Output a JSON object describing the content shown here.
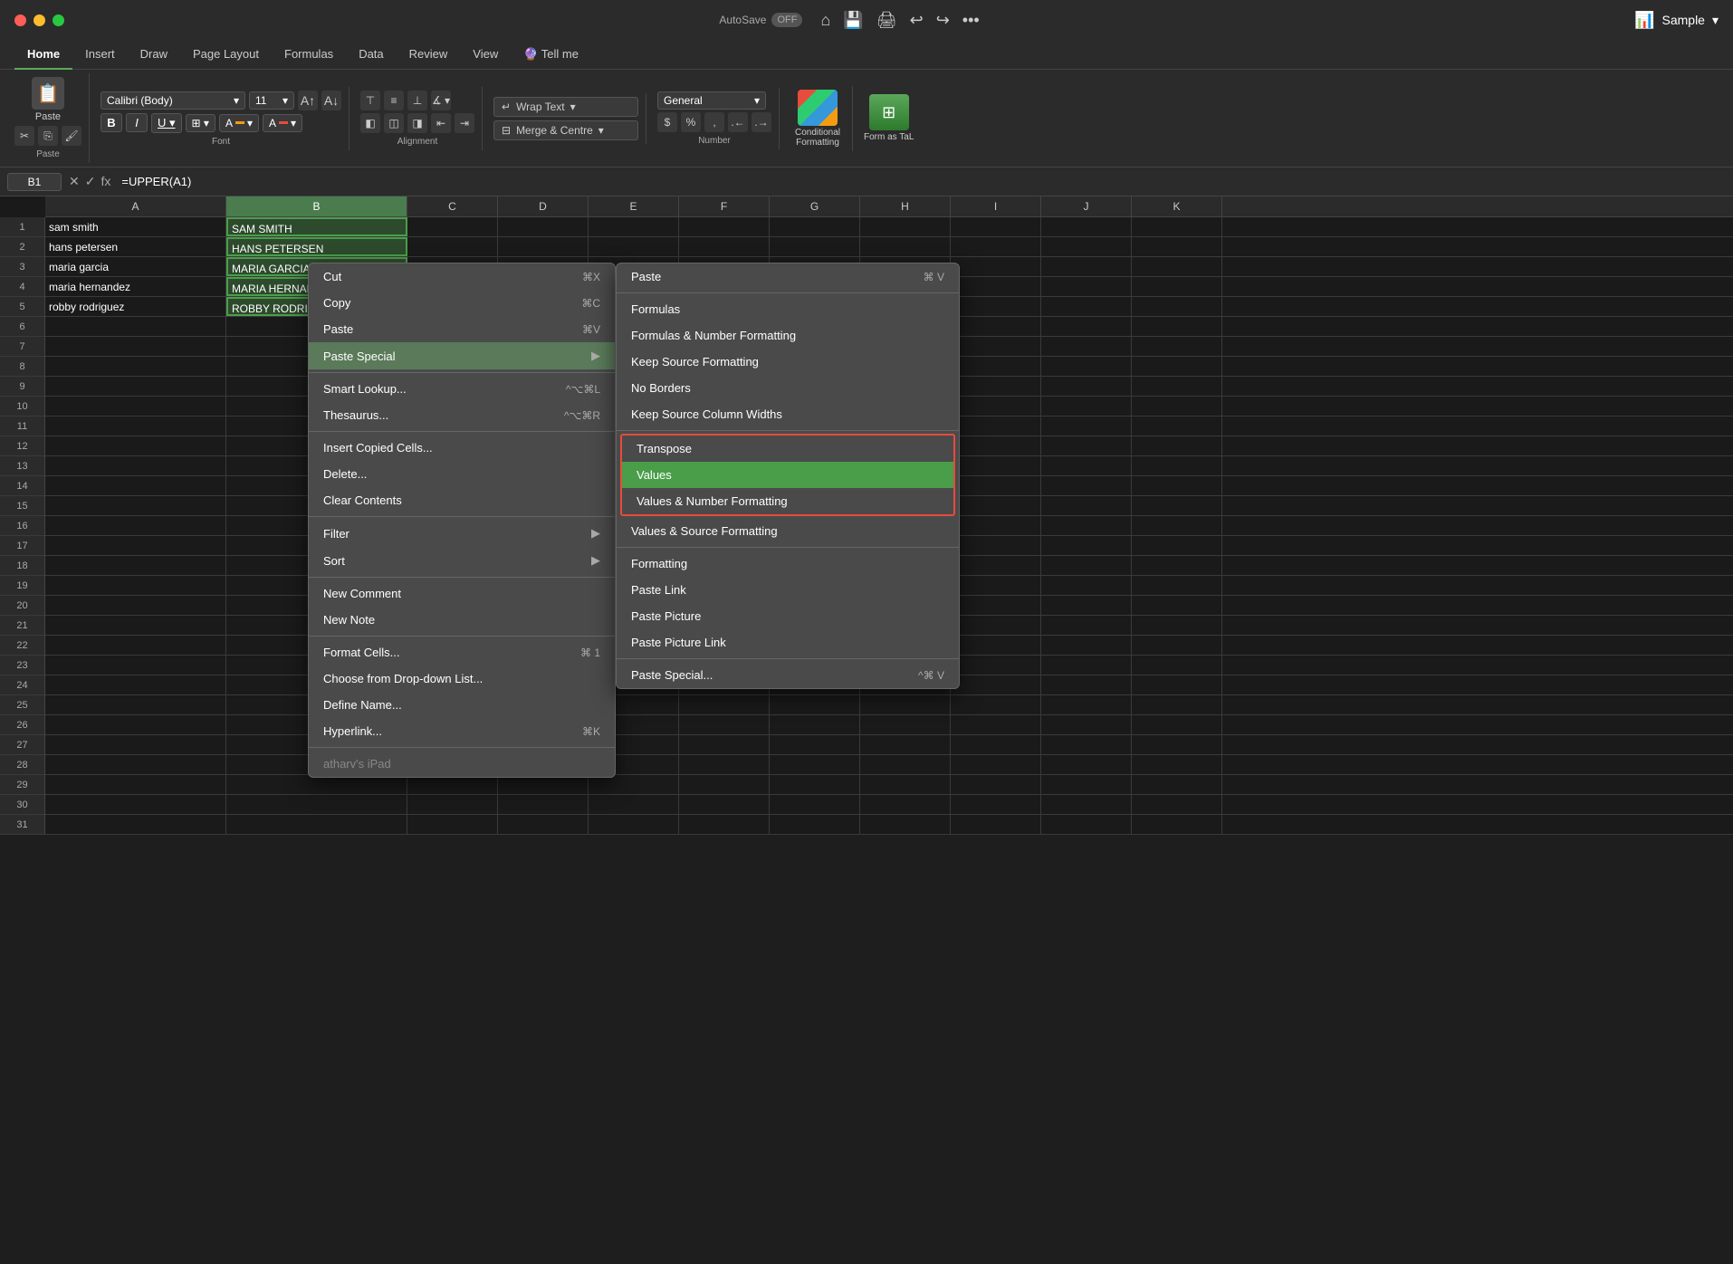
{
  "titleBar": {
    "autosave": "AutoSave",
    "toggle": "OFF",
    "appTitle": "Sample",
    "moreIcon": "•••"
  },
  "ribbonTabs": [
    "Home",
    "Insert",
    "Draw",
    "Page Layout",
    "Formulas",
    "Data",
    "Review",
    "View",
    "Tell me"
  ],
  "activeTab": "Home",
  "ribbon": {
    "paste": "Paste",
    "fontName": "Calibri (Body)",
    "fontSize": "11",
    "wrapText": "Wrap Text",
    "mergeCenter": "Merge & Centre",
    "numberFormat": "General",
    "conditionalFormatting": "Conditional Formatting",
    "formatAsTable": "Form as TaL"
  },
  "formulaBar": {
    "cellRef": "B1",
    "formula": "=UPPER(A1)"
  },
  "columns": [
    "A",
    "B",
    "C",
    "D",
    "E",
    "F",
    "G",
    "H",
    "I",
    "J",
    "K"
  ],
  "rows": [
    {
      "num": "1",
      "a": "sam smith",
      "b": "SAM SMITH"
    },
    {
      "num": "2",
      "a": "hans petersen",
      "b": "HANS PETERSEN"
    },
    {
      "num": "3",
      "a": "maria garcia",
      "b": "MARIA GARCIA"
    },
    {
      "num": "4",
      "a": "maria hernandez",
      "b": "MARIA HERNANDEZ"
    },
    {
      "num": "5",
      "a": "robby rodriguez",
      "b": "ROBBY RODRIGUEZ"
    },
    {
      "num": "6",
      "a": "",
      "b": ""
    },
    {
      "num": "7",
      "a": "",
      "b": ""
    },
    {
      "num": "8",
      "a": "",
      "b": ""
    },
    {
      "num": "9",
      "a": "",
      "b": ""
    },
    {
      "num": "10",
      "a": "",
      "b": ""
    },
    {
      "num": "11",
      "a": "",
      "b": ""
    },
    {
      "num": "12",
      "a": "",
      "b": ""
    },
    {
      "num": "13",
      "a": "",
      "b": ""
    },
    {
      "num": "14",
      "a": "",
      "b": ""
    },
    {
      "num": "15",
      "a": "",
      "b": ""
    },
    {
      "num": "16",
      "a": "",
      "b": ""
    },
    {
      "num": "17",
      "a": "",
      "b": ""
    },
    {
      "num": "18",
      "a": "",
      "b": ""
    },
    {
      "num": "19",
      "a": "",
      "b": ""
    },
    {
      "num": "20",
      "a": "",
      "b": ""
    },
    {
      "num": "21",
      "a": "",
      "b": ""
    },
    {
      "num": "22",
      "a": "",
      "b": ""
    },
    {
      "num": "23",
      "a": "",
      "b": ""
    },
    {
      "num": "24",
      "a": "",
      "b": ""
    },
    {
      "num": "25",
      "a": "",
      "b": ""
    },
    {
      "num": "26",
      "a": "",
      "b": ""
    },
    {
      "num": "27",
      "a": "",
      "b": ""
    },
    {
      "num": "28",
      "a": "",
      "b": ""
    },
    {
      "num": "29",
      "a": "",
      "b": ""
    },
    {
      "num": "30",
      "a": "",
      "b": ""
    },
    {
      "num": "31",
      "a": "",
      "b": ""
    }
  ],
  "contextMenu": {
    "items": [
      {
        "label": "Cut",
        "shortcut": "⌘X",
        "hasSubmenu": false
      },
      {
        "label": "Copy",
        "shortcut": "⌘C",
        "hasSubmenu": false
      },
      {
        "label": "Paste",
        "shortcut": "⌘V",
        "hasSubmenu": false
      },
      {
        "label": "Paste Special",
        "shortcut": "",
        "hasSubmenu": true
      },
      {
        "label": "Smart Lookup...",
        "shortcut": "^⌥⌘L",
        "hasSubmenu": false
      },
      {
        "label": "Thesaurus...",
        "shortcut": "^⌥⌘R",
        "hasSubmenu": false
      },
      {
        "label": "Insert Copied Cells...",
        "shortcut": "",
        "hasSubmenu": false
      },
      {
        "label": "Delete...",
        "shortcut": "",
        "hasSubmenu": false
      },
      {
        "label": "Clear Contents",
        "shortcut": "",
        "hasSubmenu": false
      },
      {
        "label": "Filter",
        "shortcut": "",
        "hasSubmenu": true
      },
      {
        "label": "Sort",
        "shortcut": "",
        "hasSubmenu": true
      },
      {
        "label": "New Comment",
        "shortcut": "",
        "hasSubmenu": false
      },
      {
        "label": "New Note",
        "shortcut": "",
        "hasSubmenu": false
      },
      {
        "label": "Format Cells...",
        "shortcut": "⌘ 1",
        "hasSubmenu": false
      },
      {
        "label": "Choose from Drop-down List...",
        "shortcut": "",
        "hasSubmenu": false
      },
      {
        "label": "Define Name...",
        "shortcut": "",
        "hasSubmenu": false
      },
      {
        "label": "Hyperlink...",
        "shortcut": "⌘K",
        "hasSubmenu": false
      },
      {
        "label": "atharv's iPad",
        "shortcut": "",
        "hasSubmenu": false,
        "disabled": true
      }
    ]
  },
  "pasteSubmenu": {
    "items": [
      {
        "label": "Paste",
        "shortcut": "⌘ V",
        "highlighted": false
      },
      {
        "label": "Formulas",
        "shortcut": "",
        "highlighted": false
      },
      {
        "label": "Formulas & Number Formatting",
        "shortcut": "",
        "highlighted": false
      },
      {
        "label": "Keep Source Formatting",
        "shortcut": "",
        "highlighted": false
      },
      {
        "label": "No Borders",
        "shortcut": "",
        "highlighted": false
      },
      {
        "label": "Keep Source Column Widths",
        "shortcut": "",
        "highlighted": false
      },
      {
        "label": "Transpose",
        "shortcut": "",
        "highlighted": false,
        "redOutline": true
      },
      {
        "label": "Values",
        "shortcut": "",
        "highlighted": true,
        "redOutline": true
      },
      {
        "label": "Values & Number Formatting",
        "shortcut": "",
        "highlighted": false,
        "redOutline": true
      },
      {
        "label": "Values & Source Formatting",
        "shortcut": "",
        "highlighted": false
      },
      {
        "label": "Formatting",
        "shortcut": "",
        "highlighted": false
      },
      {
        "label": "Paste Link",
        "shortcut": "",
        "highlighted": false
      },
      {
        "label": "Paste Picture",
        "shortcut": "",
        "highlighted": false
      },
      {
        "label": "Paste Picture Link",
        "shortcut": "",
        "highlighted": false
      },
      {
        "label": "Paste Special...",
        "shortcut": "^⌘ V",
        "highlighted": false
      }
    ]
  }
}
